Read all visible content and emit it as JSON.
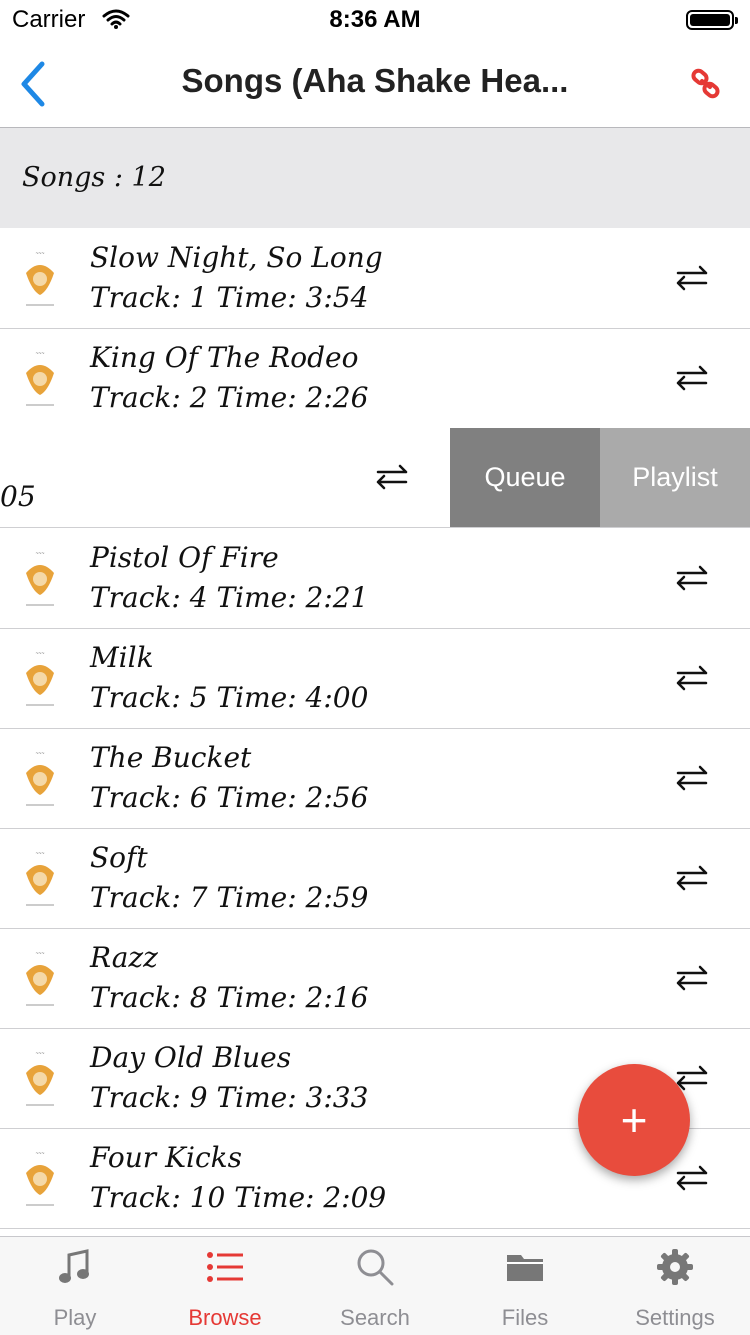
{
  "status_bar": {
    "carrier": "Carrier",
    "time": "8:36 AM"
  },
  "nav": {
    "title": "Songs (Aha Shake Hea...",
    "back_icon": "chevron-left-icon",
    "link_icon": "link-icon",
    "accent_color": "#e53935",
    "back_color": "#1e88e5"
  },
  "section": {
    "header": "Songs : 12"
  },
  "songs": [
    {
      "title": "Slow Night, So Long",
      "meta": "Track: 1 Time: 3:54"
    },
    {
      "title": "King Of The Rodeo",
      "meta": "Track: 2 Time: 2:26"
    },
    {
      "title": "",
      "meta": "05"
    },
    {
      "title": "Pistol Of Fire",
      "meta": "Track: 4 Time: 2:21"
    },
    {
      "title": "Milk",
      "meta": "Track: 5 Time: 4:00"
    },
    {
      "title": "The Bucket",
      "meta": "Track: 6 Time: 2:56"
    },
    {
      "title": "Soft",
      "meta": "Track: 7 Time: 2:59"
    },
    {
      "title": "Razz",
      "meta": "Track: 8 Time: 2:16"
    },
    {
      "title": "Day Old Blues",
      "meta": "Track: 9 Time: 3:33"
    },
    {
      "title": "Four Kicks",
      "meta": "Track: 10 Time: 2:09"
    }
  ],
  "swipe_actions": {
    "queue": "Queue",
    "playlist": "Playlist"
  },
  "fab": {
    "label": "+",
    "color": "#e84c3d"
  },
  "tabs": [
    {
      "label": "Play",
      "icon": "music-note-icon",
      "active": false
    },
    {
      "label": "Browse",
      "icon": "list-icon",
      "active": true
    },
    {
      "label": "Search",
      "icon": "search-icon",
      "active": false
    },
    {
      "label": "Files",
      "icon": "folder-icon",
      "active": false
    },
    {
      "label": "Settings",
      "icon": "gear-icon",
      "active": false
    }
  ]
}
